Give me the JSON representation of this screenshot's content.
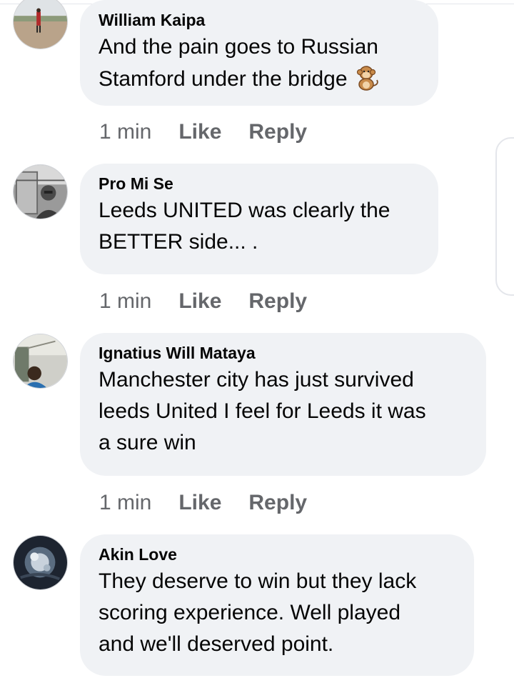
{
  "comments": [
    {
      "author": "William Kaipa",
      "text_lines": [
        "And the pain goes to Russian",
        "Stamford under the bridge"
      ],
      "emoji": "monkey-icon",
      "time": "1 min",
      "like_label": "Like",
      "reply_label": "Reply"
    },
    {
      "author": "Pro Mi Se",
      "text_lines": [
        "Leeds UNITED was clearly the",
        "BETTER side... ."
      ],
      "time": "1 min",
      "like_label": "Like",
      "reply_label": "Reply"
    },
    {
      "author": "Ignatius Will Mataya",
      "text_lines": [
        "Manchester city has just survived",
        "leeds United I feel for Leeds it was",
        "a sure win"
      ],
      "time": "1 min",
      "like_label": "Like",
      "reply_label": "Reply"
    },
    {
      "author": "Akin Love",
      "text_lines": [
        "They deserve to win but they lack",
        "scoring experience. Well played",
        "and we'll deserved point."
      ]
    }
  ],
  "colors": {
    "bubble": "#f0f2f5",
    "meta_text": "#65676b",
    "body_text": "#050505"
  }
}
